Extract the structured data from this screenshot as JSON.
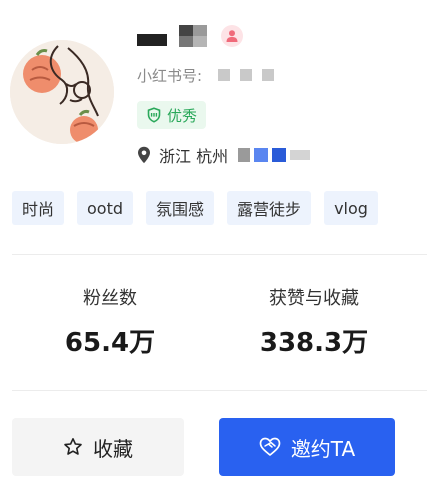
{
  "profile": {
    "red_id_label": "小红书号:",
    "badge_label": "优秀",
    "location": "浙江 杭州"
  },
  "tags": [
    "时尚",
    "ootd",
    "氛围感",
    "露营徒步",
    "vlog"
  ],
  "stats": [
    {
      "label": "粉丝数",
      "value": "65.4万"
    },
    {
      "label": "获赞与收藏",
      "value": "338.3万"
    }
  ],
  "actions": {
    "favorite_label": "收藏",
    "invite_label": "邀约TA"
  },
  "colors": {
    "badge_green": "#2aa85a",
    "tag_bg": "#edf3fd",
    "invite_blue": "#2961f0",
    "gender_pink": "#f06a7a"
  },
  "icons": [
    "avatar-illustration",
    "female-user-icon",
    "shield-check-icon",
    "location-pin-icon",
    "star-outline-icon",
    "heart-handshake-icon"
  ]
}
